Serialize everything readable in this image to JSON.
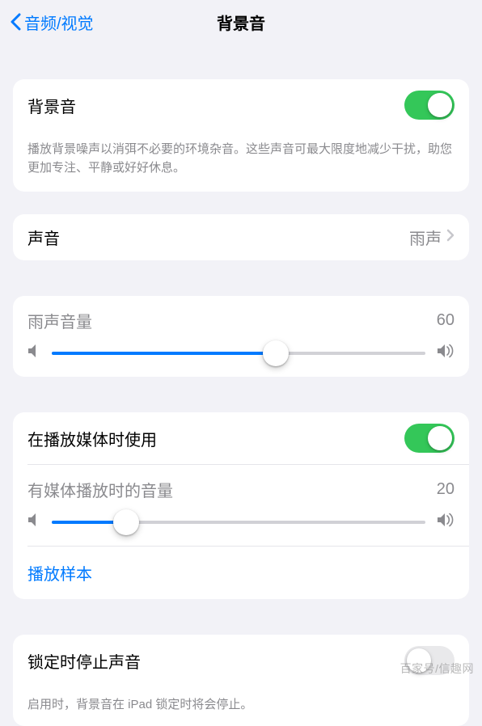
{
  "nav": {
    "back_label": "音频/视觉",
    "title": "背景音"
  },
  "group1": {
    "main_toggle": {
      "label": "背景音",
      "on": true
    },
    "footer": "播放背景噪声以消弭不必要的环境杂音。这些声音可最大限度地减少干扰，助您更加专注、平静或好好休息。"
  },
  "sound_row": {
    "label": "声音",
    "value": "雨声"
  },
  "volume1": {
    "title": "雨声音量",
    "value": 60
  },
  "media_group": {
    "toggle": {
      "label": "在播放媒体时使用",
      "on": true
    },
    "slider": {
      "title": "有媒体播放时的音量",
      "value": 20
    },
    "sample_label": "播放样本"
  },
  "lock_group": {
    "toggle": {
      "label": "锁定时停止声音",
      "on": false
    },
    "footer": "启用时，背景音在 iPad 锁定时将会停止。"
  },
  "watermark": "百家号/信趣网"
}
